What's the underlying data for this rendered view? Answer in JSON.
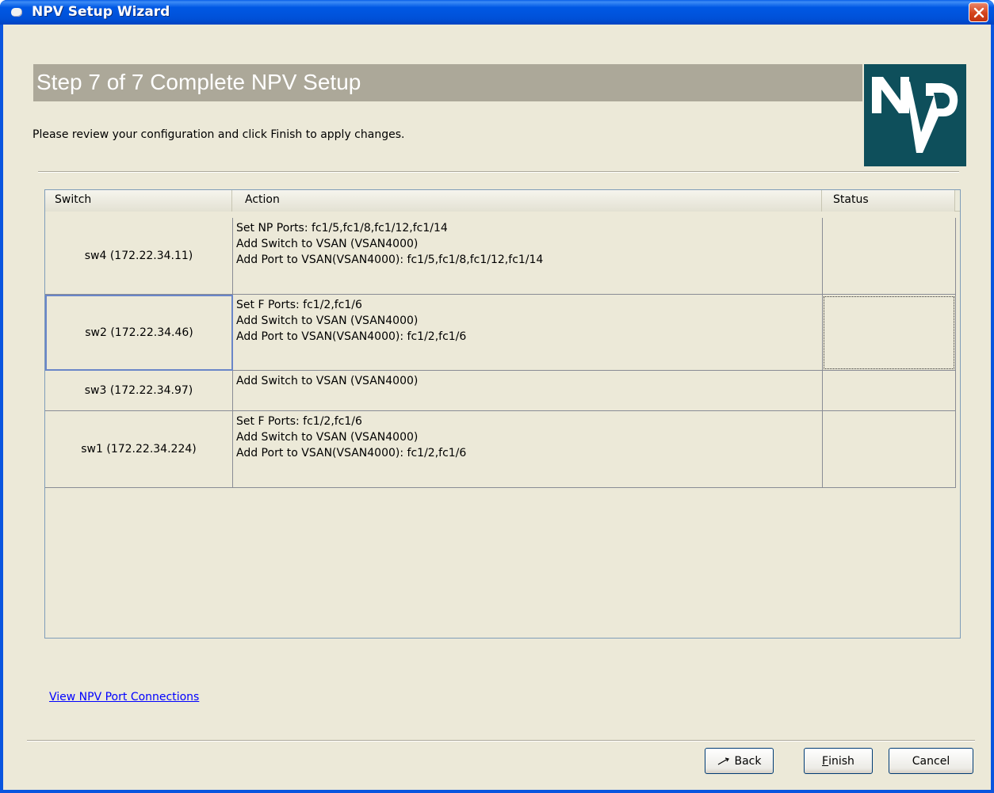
{
  "window": {
    "title": "NPV Setup Wizard"
  },
  "header": {
    "step_title": "Step 7 of 7 Complete NPV Setup",
    "instructions": "Please review your configuration and click Finish to apply changes.",
    "logo_text": "NPV",
    "logo_color": "#0e4f5b",
    "banner_color": "#aca899"
  },
  "table": {
    "columns": [
      "Switch",
      "Action",
      "Status"
    ],
    "rows": [
      {
        "switch": "sw4 (172.22.34.11)",
        "actions": [
          "Set NP Ports: fc1/5,fc1/8,fc1/12,fc1/14",
          "Add Switch to VSAN (VSAN4000)",
          "Add Port to VSAN(VSAN4000): fc1/5,fc1/8,fc1/12,fc1/14"
        ],
        "status": ""
      },
      {
        "switch": "sw2 (172.22.34.46)",
        "actions": [
          "Set F Ports: fc1/2,fc1/6",
          "Add Switch to VSAN (VSAN4000)",
          "Add Port to VSAN(VSAN4000): fc1/2,fc1/6"
        ],
        "status": ""
      },
      {
        "switch": "sw3 (172.22.34.97)",
        "actions": [
          "Add Switch to VSAN (VSAN4000)"
        ],
        "status": ""
      },
      {
        "switch": "sw1 (172.22.34.224)",
        "actions": [
          "Set F Ports: fc1/2,fc1/6",
          "Add Switch to VSAN (VSAN4000)",
          "Add Port to VSAN(VSAN4000): fc1/2,fc1/6"
        ],
        "status": ""
      }
    ]
  },
  "links": {
    "view_connections": "View NPV Port Connections"
  },
  "buttons": {
    "back": "Back",
    "finish_mnemonic": "F",
    "finish_rest": "inish",
    "cancel": "Cancel"
  },
  "colors": {
    "titlebar": "#0058e4",
    "client_bg": "#ece9d8",
    "close_button": "#d4441c",
    "link": "#0000ff"
  },
  "icons": {
    "app": "app-icon",
    "close": "close-icon",
    "back": "back-arrow-icon"
  }
}
